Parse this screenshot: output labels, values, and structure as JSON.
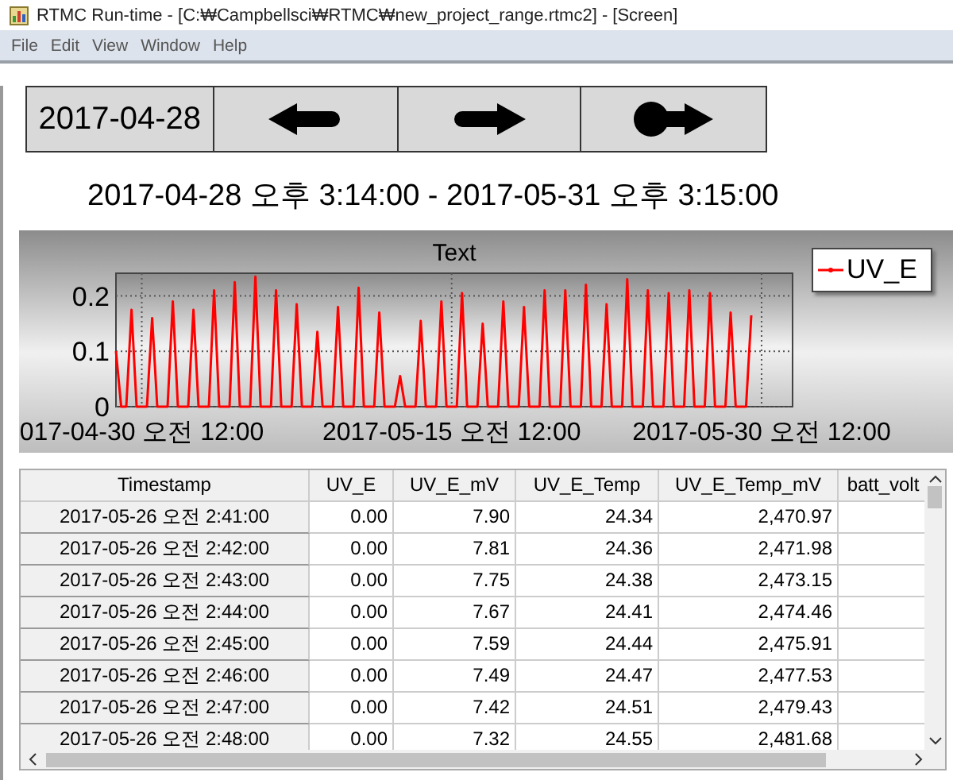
{
  "window": {
    "title": "RTMC Run-time - [C:₩Campbellsci₩RTMC₩new_project_range.rtmc2] - [Screen]"
  },
  "menu": [
    "File",
    "Edit",
    "View",
    "Window",
    "Help"
  ],
  "date_field": {
    "value": "2017-04-28"
  },
  "nav_buttons": [
    {
      "kind": "back"
    },
    {
      "kind": "forward"
    },
    {
      "kind": "end"
    }
  ],
  "range_text": "2017-04-28 오후 3:14:00 - 2017-05-31 오후 3:15:00",
  "chart": {
    "chart_data": {
      "type": "line",
      "title": "Text",
      "categories": [
        null,
        null,
        null,
        null,
        null,
        "017-04-30 오전 12:00",
        null,
        null,
        null,
        null,
        null,
        null,
        null,
        null,
        null,
        null,
        null,
        null,
        null,
        null,
        null,
        null,
        null,
        null,
        null,
        null,
        null,
        null,
        null,
        null,
        null,
        null,
        null,
        null,
        null,
        null,
        null,
        null,
        null,
        null,
        null,
        null,
        null,
        null,
        null,
        null,
        null,
        null,
        null,
        null,
        null,
        null,
        null,
        null,
        null,
        null,
        null,
        null,
        null,
        null,
        null,
        null,
        null,
        null,
        null,
        "2017-05-15 오전 12:00",
        null,
        null,
        null,
        null,
        null,
        null,
        null,
        null,
        null,
        null,
        null,
        null,
        null,
        null,
        null,
        null,
        null,
        null,
        null,
        null,
        null,
        null,
        null,
        null,
        null,
        null,
        null,
        null,
        null,
        null,
        null,
        null,
        null,
        null,
        null,
        null,
        null,
        null,
        null,
        null,
        null,
        null,
        null,
        null,
        null,
        null,
        null,
        null,
        null,
        null,
        null,
        null,
        null,
        null,
        null,
        null,
        null,
        null,
        null,
        "2017-05-30 오전 12:00",
        null,
        null,
        null,
        null,
        null,
        null
      ],
      "series": [
        {
          "name": "UV_E",
          "color": "#ff0000",
          "values": [
            0.1,
            0,
            0,
            0.175,
            0,
            0,
            0,
            0.16,
            0,
            0,
            0,
            0.19,
            0,
            0,
            0,
            0.175,
            0,
            0,
            0,
            0.21,
            0,
            0,
            0,
            0.225,
            0,
            0,
            0,
            0.235,
            0,
            0,
            0,
            0.21,
            0,
            0,
            0,
            0.185,
            0,
            0,
            0,
            0.135,
            0,
            0,
            0,
            0.18,
            0,
            0,
            0,
            0.215,
            0,
            0,
            0,
            0.17,
            0,
            0,
            0,
            0.055,
            0,
            0,
            0,
            0.155,
            0,
            0,
            0,
            0.19,
            0,
            0,
            0,
            0.205,
            0,
            0,
            0,
            0.15,
            0,
            0,
            0,
            0.19,
            0,
            0,
            0,
            0.18,
            0,
            0,
            0,
            0.21,
            0,
            0,
            0,
            0.21,
            0,
            0,
            0,
            0.22,
            0,
            0,
            0,
            0.185,
            0,
            0,
            0,
            0.23,
            0,
            0,
            0,
            0.21,
            0,
            0,
            0,
            0.205,
            0,
            0,
            0,
            0.21,
            0,
            0,
            0,
            0.205,
            0,
            0,
            0,
            0.17,
            0,
            0,
            0,
            0.165,
            null,
            null,
            null,
            null,
            null,
            null,
            null,
            null
          ]
        }
      ],
      "ylim": [
        0,
        0.241
      ],
      "yticks": [
        {
          "value": 0.2,
          "label": "0.2"
        },
        {
          "value": 0.1,
          "label": "0.1"
        },
        {
          "value": 0,
          "label": "0"
        }
      ]
    }
  },
  "table": {
    "columns": [
      "Timestamp",
      "UV_E",
      "UV_E_mV",
      "UV_E_Temp",
      "UV_E_Temp_mV",
      "batt_volt"
    ],
    "rows": [
      [
        "2017-05-26 오전 2:41:00",
        "0.00",
        "7.90",
        "24.34",
        "2,470.97"
      ],
      [
        "2017-05-26 오전 2:42:00",
        "0.00",
        "7.81",
        "24.36",
        "2,471.98"
      ],
      [
        "2017-05-26 오전 2:43:00",
        "0.00",
        "7.75",
        "24.38",
        "2,473.15"
      ],
      [
        "2017-05-26 오전 2:44:00",
        "0.00",
        "7.67",
        "24.41",
        "2,474.46"
      ],
      [
        "2017-05-26 오전 2:45:00",
        "0.00",
        "7.59",
        "24.44",
        "2,475.91"
      ],
      [
        "2017-05-26 오전 2:46:00",
        "0.00",
        "7.49",
        "24.47",
        "2,477.53"
      ],
      [
        "2017-05-26 오전 2:47:00",
        "0.00",
        "7.42",
        "24.51",
        "2,479.43"
      ],
      [
        "2017-05-26 오전 2:48:00",
        "0.00",
        "7.32",
        "24.55",
        "2,481.68"
      ]
    ]
  }
}
